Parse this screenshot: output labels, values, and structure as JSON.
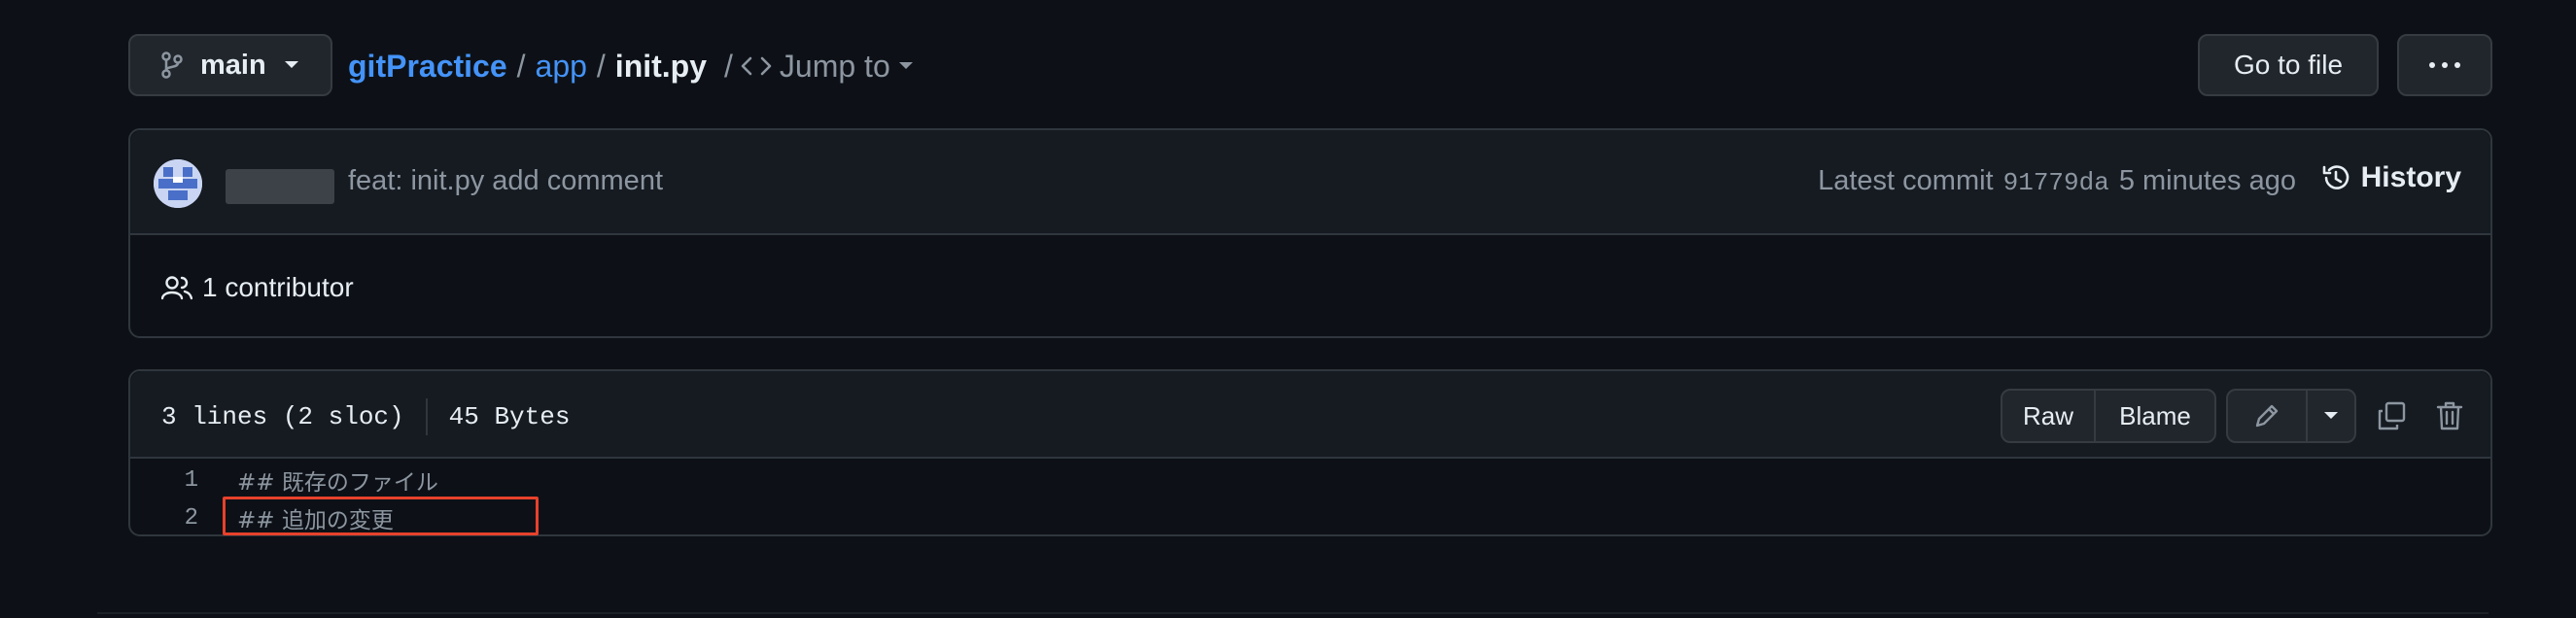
{
  "branch": {
    "label": "main",
    "icon": "git-branch-icon",
    "caret": "caret-down-icon"
  },
  "breadcrumb": {
    "repo": "gitPractice",
    "sep1": "/",
    "folder": "app",
    "sep2": "/",
    "file": "init.py",
    "sep3": "/",
    "jump_icon": "code-icon",
    "jump_label": "Jump to"
  },
  "toolbar": {
    "go_to_file": "Go to file",
    "more_icon": "kebab-horizontal-icon"
  },
  "commit": {
    "author_redacted": true,
    "message": "feat: init.py add comment",
    "latest_label": "Latest commit",
    "sha": "91779da",
    "time": "5 minutes ago",
    "history_label": "History"
  },
  "contributors": {
    "label": "1 contributor",
    "icon": "people-icon"
  },
  "file": {
    "lines_info": "3 lines (2 sloc)",
    "size": "45 Bytes",
    "raw_label": "Raw",
    "blame_label": "Blame",
    "code_lines": [
      {
        "num": "1",
        "text": "## 既存のファイル"
      },
      {
        "num": "2",
        "text": "## 追加の変更"
      }
    ]
  },
  "colors": {
    "accent_link": "#4493f8",
    "highlight_box": "#e8412c",
    "background": "#0d1117"
  }
}
